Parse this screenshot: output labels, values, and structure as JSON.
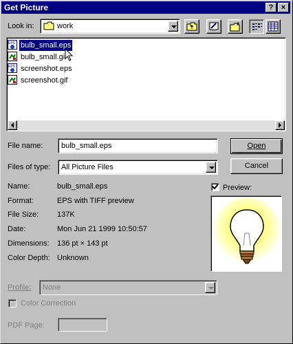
{
  "dialog": {
    "title": "Get Picture",
    "title_buttons": {
      "help": "?",
      "close": "×"
    }
  },
  "look_in": {
    "label": "Look in:",
    "value": "work"
  },
  "toolbar": {
    "up_icon": "up-folder-icon",
    "desktop_icon": "desktop-icon",
    "new_folder_icon": "new-folder-icon",
    "list_icon": "list-view-icon",
    "details_icon": "details-view-icon"
  },
  "files": [
    {
      "name": "bulb_small.eps",
      "icon": "eps-file-icon",
      "selected": true
    },
    {
      "name": "bulb_small.gif",
      "icon": "gif-file-icon",
      "selected": false
    },
    {
      "name": "screenshot.eps",
      "icon": "eps-file-icon",
      "selected": false
    },
    {
      "name": "screenshot.gif",
      "icon": "gif-file-icon",
      "selected": false
    }
  ],
  "file_name": {
    "label": "File name:",
    "value": "bulb_small.eps"
  },
  "file_type": {
    "label": "Files of type:",
    "value": "All Picture Files"
  },
  "buttons": {
    "open": "Open",
    "cancel": "Cancel"
  },
  "info": {
    "name_label": "Name:",
    "name_value": "bulb_small.eps",
    "format_label": "Format:",
    "format_value": "EPS with TIFF preview",
    "size_label": "File Size:",
    "size_value": "137K",
    "date_label": "Date:",
    "date_value": "Mon Jun 21 1999 10:50:57",
    "dimensions_label": "Dimensions:",
    "dimensions_value": "136 pt × 143 pt",
    "depth_label": "Color Depth:",
    "depth_value": "Unknown"
  },
  "preview": {
    "label": "Preview:",
    "checked": true
  },
  "profile": {
    "label": "Profile:",
    "value": "None"
  },
  "color_correction": {
    "label": "Color Correction"
  },
  "pdf_page": {
    "label": "PDF Page:",
    "value": ""
  }
}
